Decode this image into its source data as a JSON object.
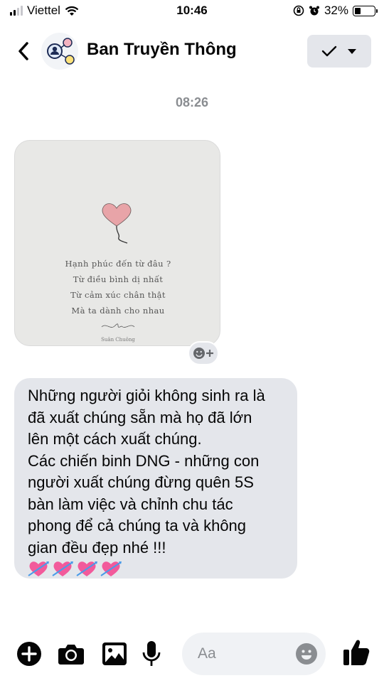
{
  "status_bar": {
    "carrier": "Viettel",
    "time": "10:46",
    "battery_percent": "32%",
    "battery_level": 0.32
  },
  "header": {
    "title": "Ban Truyền Thông"
  },
  "chat": {
    "timestamp": "08:26",
    "image_message": {
      "lines": [
        "Hạnh phúc đến từ đâu ?",
        "Từ điều bình dị nhất",
        "Từ cảm xúc chân thật",
        "Mà ta dành cho nhau"
      ],
      "signature": "Suân Chuông"
    },
    "text_message": "Những người giỏi không sinh ra là\nđã xuất chúng sẵn mà họ đã lớn\nlên một cách xuất chúng.\nCác chiến binh DNG - những con\nngười xuất chúng đừng quên 5S\nbàn làm việc và chỉnh chu tác\nphong để cả chúng ta và không\ngian đều đẹp nhé !!!",
    "text_message_emojis": [
      "💘",
      "💘",
      "💘",
      "💘"
    ]
  },
  "composer": {
    "placeholder": "Aa"
  },
  "colors": {
    "accent": "#050505",
    "bubble": "#e4e6eb",
    "heart": "#e8a4a8"
  }
}
